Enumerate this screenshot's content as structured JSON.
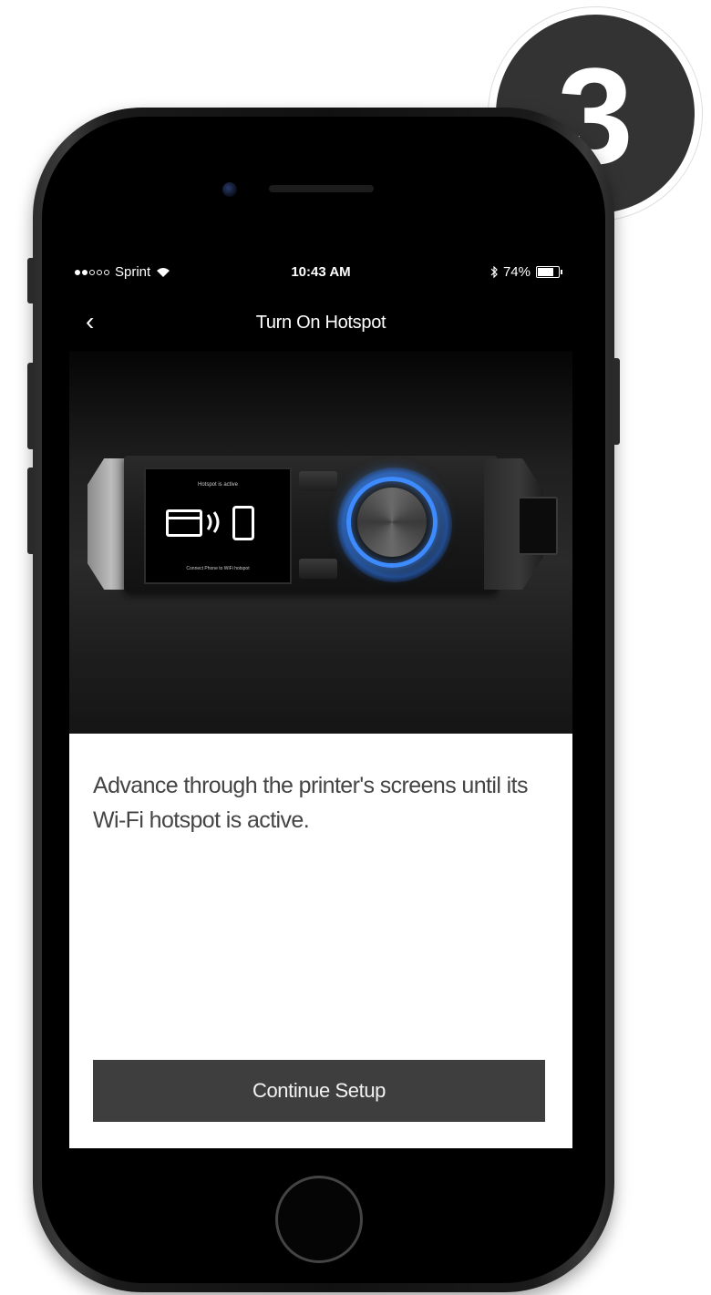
{
  "status_bar": {
    "carrier": "Sprint",
    "time": "10:43 AM",
    "battery": "74%",
    "battery_level": 0.74
  },
  "nav": {
    "title": "Turn On Hotspot",
    "back_label": "‹"
  },
  "printer_display": {
    "title": "Hotspot is active",
    "footer": "Connect Phone to WiFi hotspot"
  },
  "content": {
    "instruction": "Advance through the printer's screens until its Wi-Fi hotspot is active.",
    "continue_label": "Continue Setup"
  },
  "step_badge": {
    "number": "3"
  },
  "colors": {
    "button_bg": "#3e3e3e",
    "dial_ring": "#3e8bff",
    "badge_bg": "#333333"
  }
}
